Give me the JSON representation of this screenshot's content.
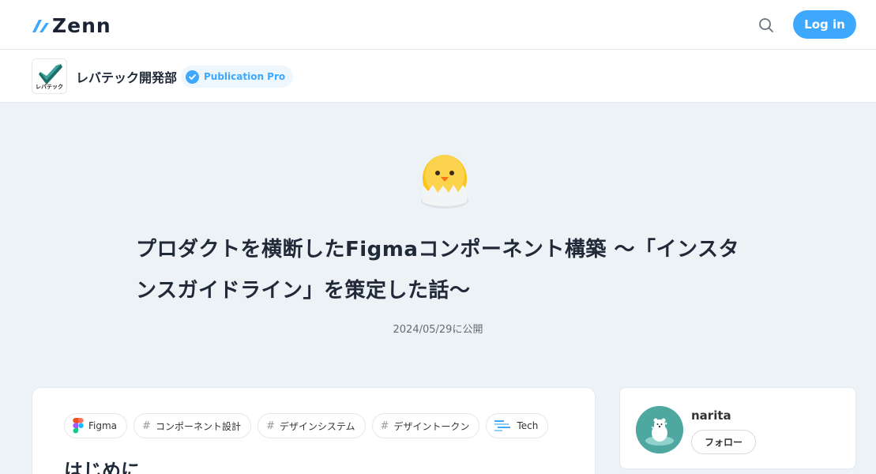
{
  "header": {
    "logo_text": "Zenn",
    "login_label": "Log in",
    "accent": "#3ea8ff"
  },
  "publication": {
    "name": "レバテック開発部",
    "logo_caption": "レバテック",
    "badge_label": "Publication Pro"
  },
  "article": {
    "emoji": "hatching-chick",
    "title": "プロダクトを横断したFigmaコンポーネント構築 〜「インスタンスガイドライン」を策定した話〜",
    "date": "2024/05/29",
    "published_label": "に公開",
    "tags": [
      {
        "icon": "figma-icon",
        "label": "Figma"
      },
      {
        "icon": "hash",
        "label": "コンポーネント設計"
      },
      {
        "icon": "hash",
        "label": "デザインシステム"
      },
      {
        "icon": "hash",
        "label": "デザイントークン"
      },
      {
        "icon": "tech-icon",
        "label": "Tech"
      }
    ],
    "first_heading": "はじめに"
  },
  "author": {
    "name": "narita",
    "follow_label": "フォロー"
  }
}
